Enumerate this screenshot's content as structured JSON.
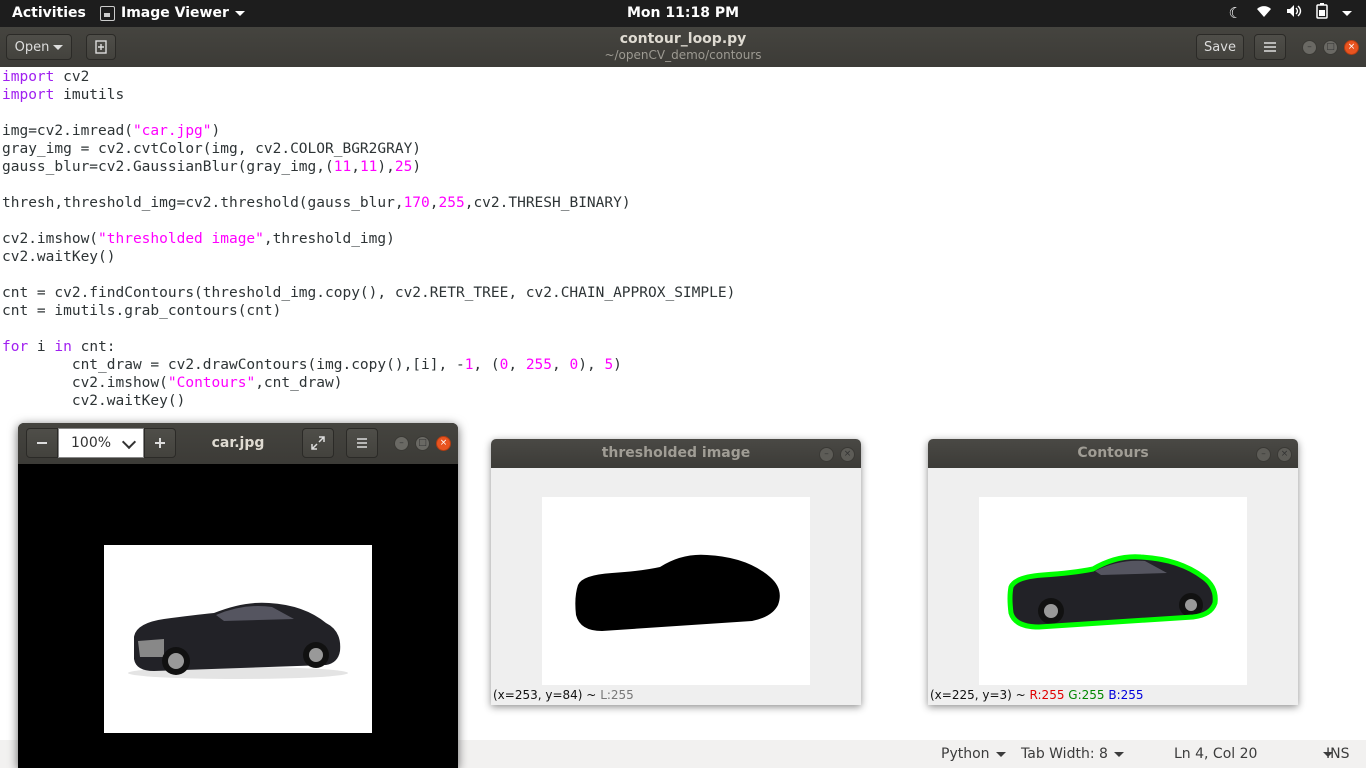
{
  "topbar": {
    "activities": "Activities",
    "app_menu": "Image Viewer",
    "clock": "Mon 11:18 PM"
  },
  "header": {
    "open_label": "Open",
    "title": "contour_loop.py",
    "subtitle": "~/openCV_demo/contours",
    "save_label": "Save"
  },
  "code_lines": [
    [
      {
        "t": "import",
        "c": "kw"
      },
      {
        "t": " cv2"
      }
    ],
    [
      {
        "t": "import",
        "c": "kw"
      },
      {
        "t": " imutils"
      }
    ],
    [],
    [
      {
        "t": "img=cv2.imread("
      },
      {
        "t": "\"car.jpg\"",
        "c": "str"
      },
      {
        "t": ")"
      }
    ],
    [
      {
        "t": "gray_img = cv2.cvtColor(img, cv2.COLOR_BGR2GRAY)"
      }
    ],
    [
      {
        "t": "gauss_blur=cv2.GaussianBlur(gray_img,("
      },
      {
        "t": "11",
        "c": "num"
      },
      {
        "t": ","
      },
      {
        "t": "11",
        "c": "num"
      },
      {
        "t": "),"
      },
      {
        "t": "25",
        "c": "num"
      },
      {
        "t": ")"
      }
    ],
    [],
    [
      {
        "t": "thresh,threshold_img=cv2.threshold(gauss_blur,"
      },
      {
        "t": "170",
        "c": "num"
      },
      {
        "t": ","
      },
      {
        "t": "255",
        "c": "num"
      },
      {
        "t": ",cv2.THRESH_BINARY)"
      }
    ],
    [],
    [
      {
        "t": "cv2.imshow("
      },
      {
        "t": "\"thresholded image\"",
        "c": "str"
      },
      {
        "t": ",threshold_img)"
      }
    ],
    [
      {
        "t": "cv2.waitKey()"
      }
    ],
    [],
    [
      {
        "t": "cnt = cv2.findContours(threshold_img.copy(), cv2.RETR_TREE, cv2.CHAIN_APPROX_SIMPLE)"
      }
    ],
    [
      {
        "t": "cnt = imutils.grab_contours(cnt)"
      }
    ],
    [],
    [
      {
        "t": "for",
        "c": "kw"
      },
      {
        "t": " i "
      },
      {
        "t": "in",
        "c": "kw"
      },
      {
        "t": " cnt:"
      }
    ],
    [
      {
        "t": "        cnt_draw = cv2.drawContours(img.copy(),[i], -"
      },
      {
        "t": "1",
        "c": "num"
      },
      {
        "t": ", ("
      },
      {
        "t": "0",
        "c": "num"
      },
      {
        "t": ", "
      },
      {
        "t": "255",
        "c": "num"
      },
      {
        "t": ", "
      },
      {
        "t": "0",
        "c": "num"
      },
      {
        "t": "), "
      },
      {
        "t": "5",
        "c": "num"
      },
      {
        "t": ")"
      }
    ],
    [
      {
        "t": "        cv2.imshow("
      },
      {
        "t": "\"Contours\"",
        "c": "str"
      },
      {
        "t": ",cnt_draw)"
      }
    ],
    [
      {
        "t": "        cv2.waitKey()"
      }
    ]
  ],
  "statusbar": {
    "language": "Python",
    "tab_width": "Tab Width: 8",
    "position": "Ln 4, Col 20",
    "mode": "INS"
  },
  "image_viewer": {
    "zoom": "100%",
    "title": "car.jpg"
  },
  "threshold_window": {
    "title": "thresholded image",
    "status_coords": "(x=253, y=84) ~",
    "status_value": "L:255"
  },
  "contours_window": {
    "title": "Contours",
    "status_coords": "(x=225, y=3) ~",
    "r": "R:255",
    "g": "G:255",
    "b": "B:255"
  },
  "colors": {
    "keyword": "#a020f0",
    "string": "#ff00ff",
    "contour": "#00ff00",
    "accent": "#e95420"
  }
}
